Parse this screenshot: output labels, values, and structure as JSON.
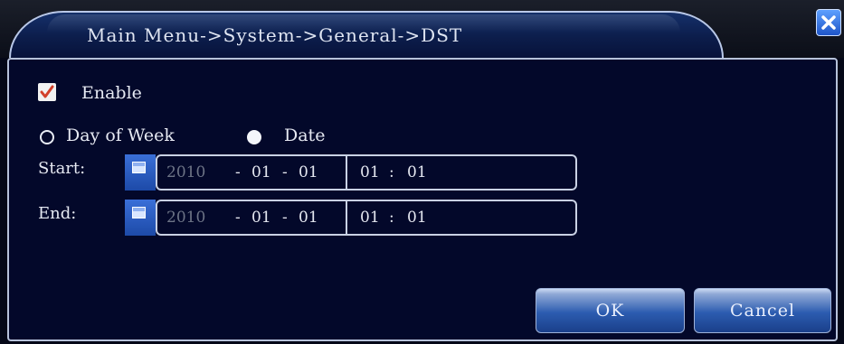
{
  "window": {
    "title": "Main Menu->System->General->DST"
  },
  "enable": {
    "label": "Enable",
    "checked": true
  },
  "mode": {
    "options": [
      "Day of Week",
      "Date"
    ],
    "selected": "Date"
  },
  "start": {
    "label": "Start:",
    "year": "2010",
    "month": "01",
    "day": "01",
    "hour": "01",
    "minute": "01"
  },
  "end": {
    "label": "End:",
    "year": "2010",
    "month": "01",
    "day": "01",
    "hour": "01",
    "minute": "01"
  },
  "buttons": {
    "ok_label": "OK",
    "cancel_label": "Cancel"
  },
  "separators": {
    "date": "-",
    "time": ":"
  },
  "icons": {
    "close": "close-icon",
    "calendar": "calendar-icon",
    "check": "checkmark-icon"
  },
  "colors": {
    "panel": "#03082a",
    "accent": "#1d4aa8",
    "check": "#d2402a"
  }
}
